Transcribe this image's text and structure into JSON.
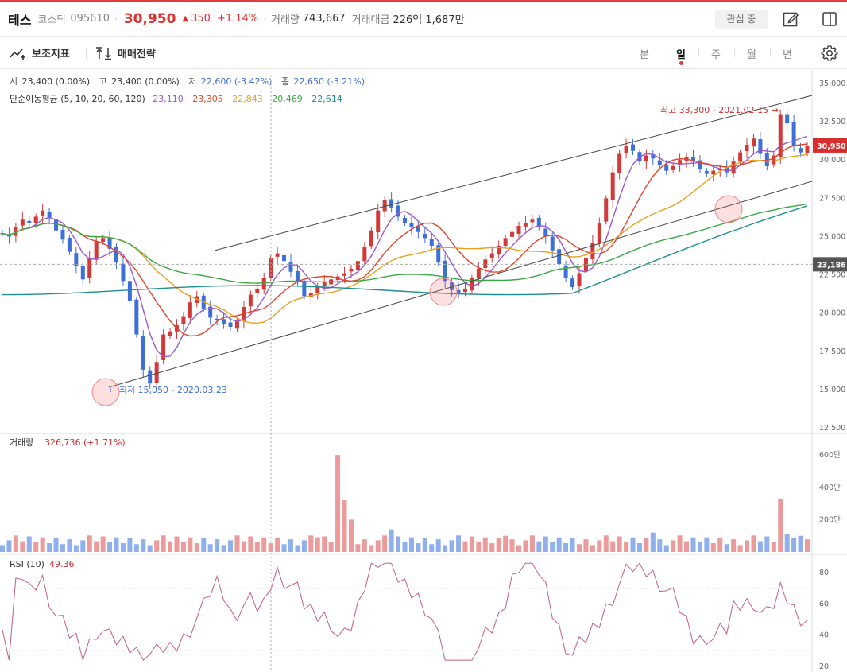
{
  "header": {
    "name": "테스",
    "market": "코스닥",
    "code": "095610",
    "price": "30,950",
    "change_arrow": "▲",
    "change": "350",
    "change_pct": "+1.14%",
    "volume_label": "거래량",
    "volume": "743,667",
    "amount_label": "거래대금",
    "amount": "226억 1,687만",
    "watch_label": "관심 중"
  },
  "toolbar": {
    "indicator_label": "보조지표",
    "strategy_label": "매매전략",
    "periods": [
      "분",
      "일",
      "주",
      "월",
      "년"
    ],
    "active_period": "일"
  },
  "price_panel": {
    "open_label": "시",
    "open": "23,400 (0.00%)",
    "high_label": "고",
    "high": "23,400 (0.00%)",
    "low_label": "저",
    "low": "22,600 (-3.42%)",
    "close_label": "종",
    "close": "22,650 (-3.21%)",
    "ma_label": "단순이동평균 (5, 10, 20, 60, 120)",
    "ma_values": [
      {
        "value": "23,110",
        "color": "#9b59d0"
      },
      {
        "value": "23,305",
        "color": "#e0442a"
      },
      {
        "value": "22,843",
        "color": "#e8a020"
      },
      {
        "value": "20,469",
        "color": "#3aa845"
      },
      {
        "value": "22,614",
        "color": "#1f8f8f"
      }
    ],
    "high_marker": "최고 33,300 - 2021.02.15 →",
    "low_marker": "← 최저 15,050 - 2020.03.23",
    "current_price_tag": "30,950",
    "crosshair_tag": "23,186"
  },
  "volume_panel": {
    "label": "거래량",
    "value": "326,736 (+1.71%)"
  },
  "rsi_panel": {
    "label": "RSI (10)",
    "value": "49.36"
  },
  "chart_data": [
    {
      "type": "candlestick",
      "panel": "price",
      "y_axis_ticks": [
        35000,
        32500,
        30000,
        27500,
        25000,
        22500,
        20000,
        17500,
        15000,
        12500
      ],
      "y_axis_labels": [
        "35,000",
        "32,500",
        "30,000",
        "27,500",
        "25,000",
        "22,500",
        "20,000",
        "17,500",
        "15,000",
        "12,500"
      ],
      "ylim": [
        12500,
        35600
      ],
      "close_series": [
        25200,
        25000,
        25600,
        26100,
        25900,
        26300,
        26700,
        26200,
        25400,
        24800,
        24000,
        23100,
        22200,
        23600,
        24700,
        24900,
        24200,
        23300,
        22100,
        20800,
        18600,
        16300,
        15400,
        16800,
        18600,
        18800,
        19200,
        19800,
        20700,
        21100,
        20300,
        19700,
        19600,
        19300,
        19100,
        19500,
        20400,
        21200,
        21600,
        22300,
        23600,
        23900,
        23400,
        22700,
        22000,
        21100,
        21300,
        21700,
        22000,
        22200,
        22400,
        22600,
        22900,
        23400,
        24300,
        25400,
        26700,
        27400,
        26900,
        26300,
        25900,
        25600,
        25300,
        24900,
        24400,
        23300,
        22100,
        21500,
        21300,
        21600,
        22300,
        22900,
        23500,
        23900,
        24400,
        24900,
        25300,
        25700,
        25900,
        26100,
        25600,
        25000,
        24100,
        23200,
        22300,
        21700,
        22600,
        23600,
        24600,
        25900,
        27500,
        29200,
        30400,
        30900,
        30600,
        29900,
        30300,
        30100,
        29700,
        29300,
        29600,
        30000,
        30200,
        29900,
        29400,
        29100,
        29300,
        29400,
        29200,
        29900,
        30500,
        31000,
        31400,
        30400,
        29600,
        30300,
        33000,
        32400,
        30900,
        30500,
        30950
      ],
      "ma_series": [
        "MA5",
        "MA10",
        "MA20",
        "MA60",
        "MA120"
      ],
      "annotations": [
        "최고 33,300 - 2021.02.15",
        "최저 15,050 - 2020.03.23"
      ],
      "current_price": 30950,
      "crosshair_price": 23186
    },
    {
      "type": "bar",
      "panel": "volume",
      "y_axis_labels": [
        "600만",
        "400만",
        "200만"
      ],
      "ylim": [
        0,
        6500000
      ],
      "notable_values": [
        6000000,
        3200000,
        2000000
      ]
    },
    {
      "type": "line",
      "panel": "rsi",
      "y_axis_labels": [
        "80",
        "60",
        "40",
        "20"
      ],
      "ylim": [
        20,
        90
      ],
      "reference_lines": [
        70,
        30
      ],
      "last_value": 49.36
    }
  ],
  "colors": {
    "up": "#d23a3a",
    "down": "#3d6fd8",
    "accent": "#e23b3b",
    "rsi": "#c0607a"
  }
}
